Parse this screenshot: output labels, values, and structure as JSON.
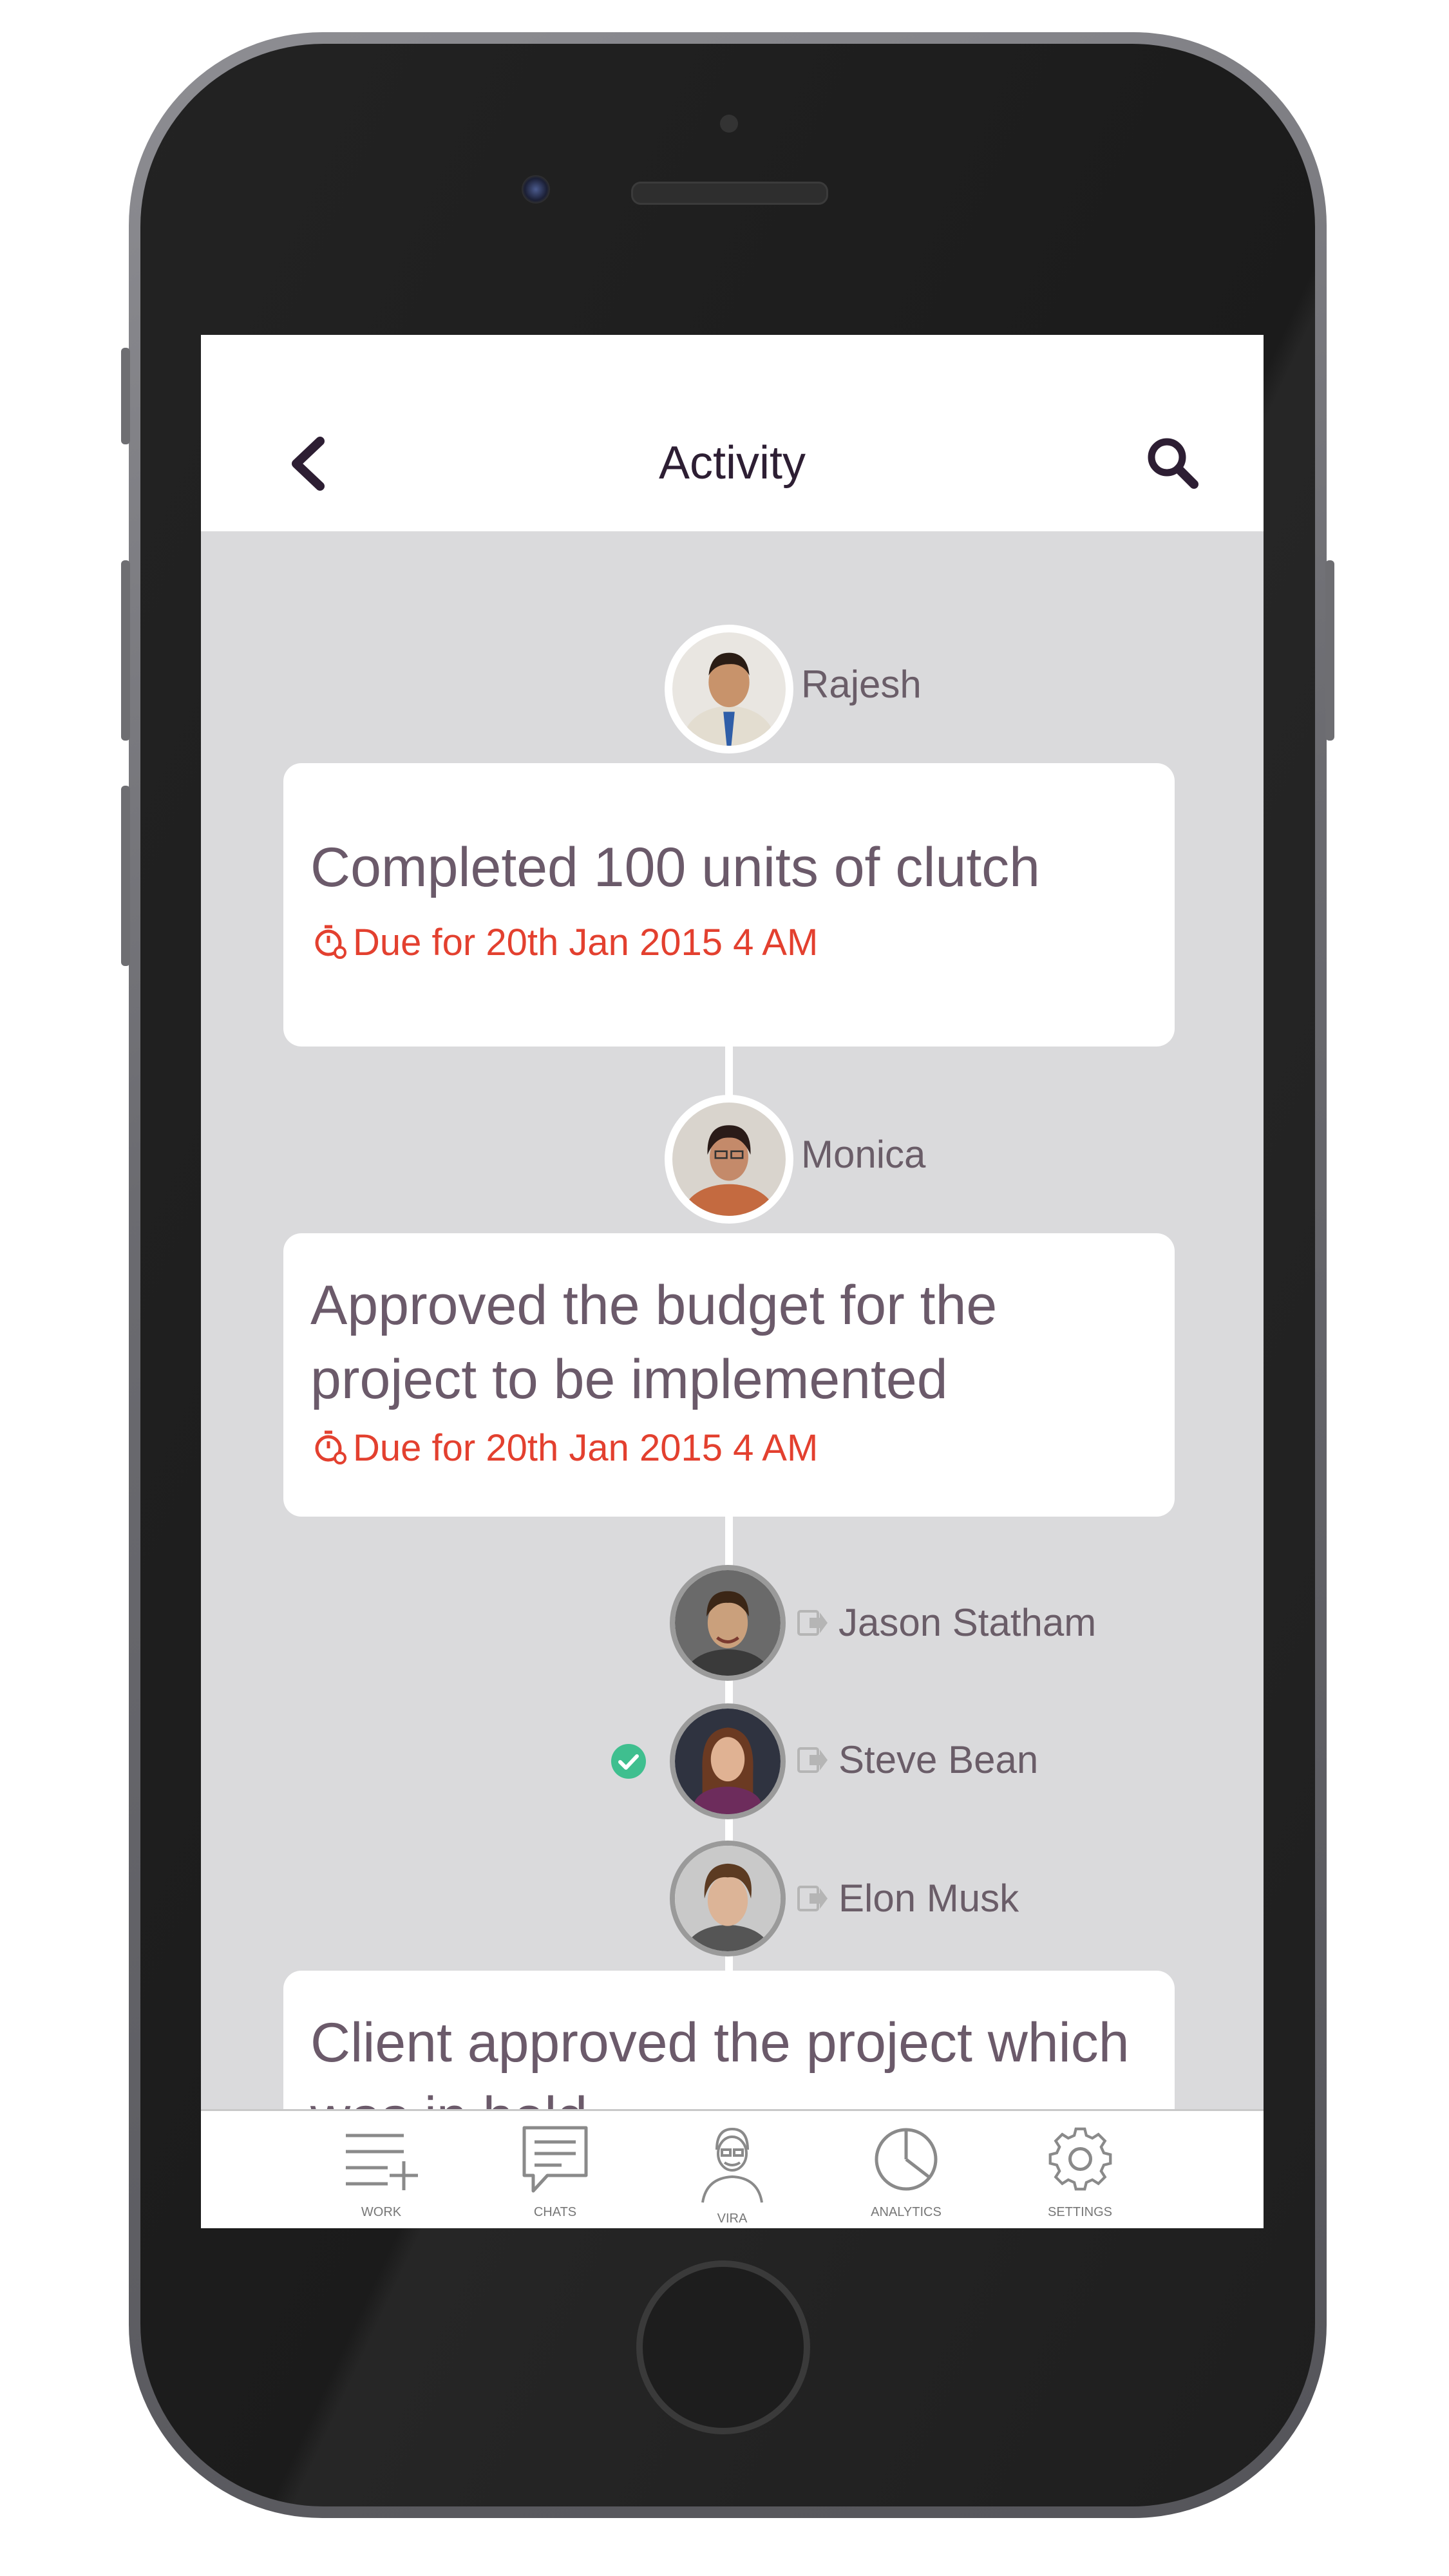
{
  "header": {
    "title": "Activity"
  },
  "activities": [
    {
      "user": "Rajesh",
      "title": "Completed 100 units of clutch",
      "due": "Due for 20th Jan 2015 4 AM"
    },
    {
      "user": "Monica",
      "title_lines": [
        "Approved the budget for the",
        "project to be implemented"
      ],
      "due": "Due for 20th Jan 2015 4 AM"
    }
  ],
  "assignees": [
    {
      "name": "Jason Statham",
      "checked": false
    },
    {
      "name": "Steve Bean",
      "checked": true
    },
    {
      "name": "Elon Musk",
      "checked": false
    }
  ],
  "last_card": {
    "title_lines": [
      "Client approved the project which",
      "was in hold"
    ]
  },
  "tabs": [
    {
      "label": "WORK",
      "icon": "work-icon"
    },
    {
      "label": "CHATS",
      "icon": "chat-icon"
    },
    {
      "label": "VIRA",
      "icon": "vira-avatar-icon"
    },
    {
      "label": "ANALYTICS",
      "icon": "pie-chart-icon"
    },
    {
      "label": "SETTINGS",
      "icon": "gear-icon"
    }
  ],
  "colors": {
    "accent": "#2d1e33",
    "due": "#e3402f",
    "check": "#3fbf8f",
    "background": "#dadadc"
  }
}
